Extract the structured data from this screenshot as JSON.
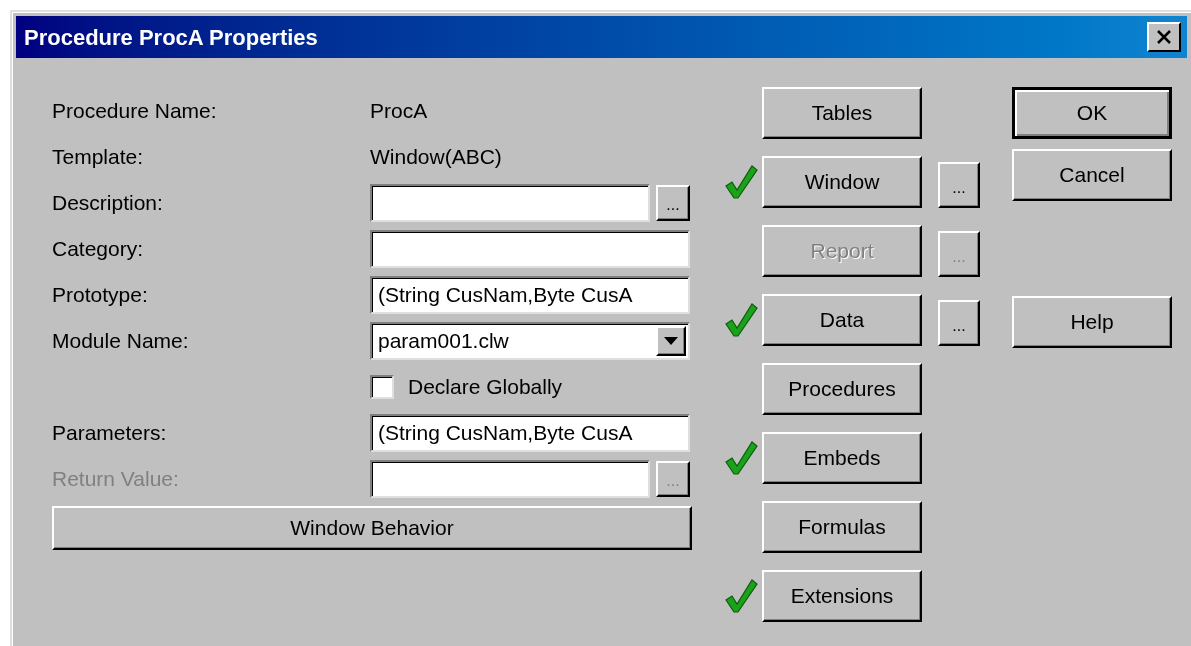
{
  "window": {
    "title": "Procedure ProcA Properties"
  },
  "fields": [
    {
      "kind": "static",
      "label": "Procedure Name:",
      "value": "ProcA",
      "disabled": false
    },
    {
      "kind": "static",
      "label": "Template:",
      "value": "Window(ABC)",
      "disabled": false
    },
    {
      "kind": "text_ellipsis",
      "label": "Description:",
      "ellipsis": "...",
      "disabled": false
    },
    {
      "kind": "text",
      "label": "Category:",
      "disabled": false
    },
    {
      "kind": "text",
      "label": "Prototype:",
      "value": "(String CusNam,Byte CusA",
      "disabled": false
    },
    {
      "kind": "dropdown",
      "label": "Module Name:",
      "value": "param001.clw",
      "disabled": false
    },
    {
      "kind": "checkbox",
      "label": "Declare Globally",
      "checked": false,
      "disabled": false
    },
    {
      "kind": "text",
      "label": "Parameters:",
      "value": "(String CusNam,Byte CusA",
      "disabled": false
    },
    {
      "kind": "text_ellipsis",
      "label": "Return Value:",
      "ellipsis": "...",
      "disabled": true
    }
  ],
  "behavior_button": "Window Behavior",
  "sections": [
    {
      "label": "Tables",
      "done": false,
      "disabled": false
    },
    {
      "label": "Window",
      "done": true,
      "disabled": false,
      "ellipsis": "..."
    },
    {
      "label": "Report",
      "done": false,
      "disabled": true,
      "ellipsis": "..."
    },
    {
      "label": "Data",
      "done": true,
      "disabled": false,
      "ellipsis": "..."
    },
    {
      "label": "Procedures",
      "done": false,
      "disabled": false
    },
    {
      "label": "Embeds",
      "done": true,
      "disabled": false
    },
    {
      "label": "Formulas",
      "done": false,
      "disabled": false
    },
    {
      "label": "Extensions",
      "done": true,
      "disabled": false
    }
  ],
  "dialog_buttons": [
    {
      "label": "OK",
      "default": true
    },
    {
      "label": "Cancel",
      "default": false
    },
    {
      "label": "Help",
      "default": false
    }
  ]
}
